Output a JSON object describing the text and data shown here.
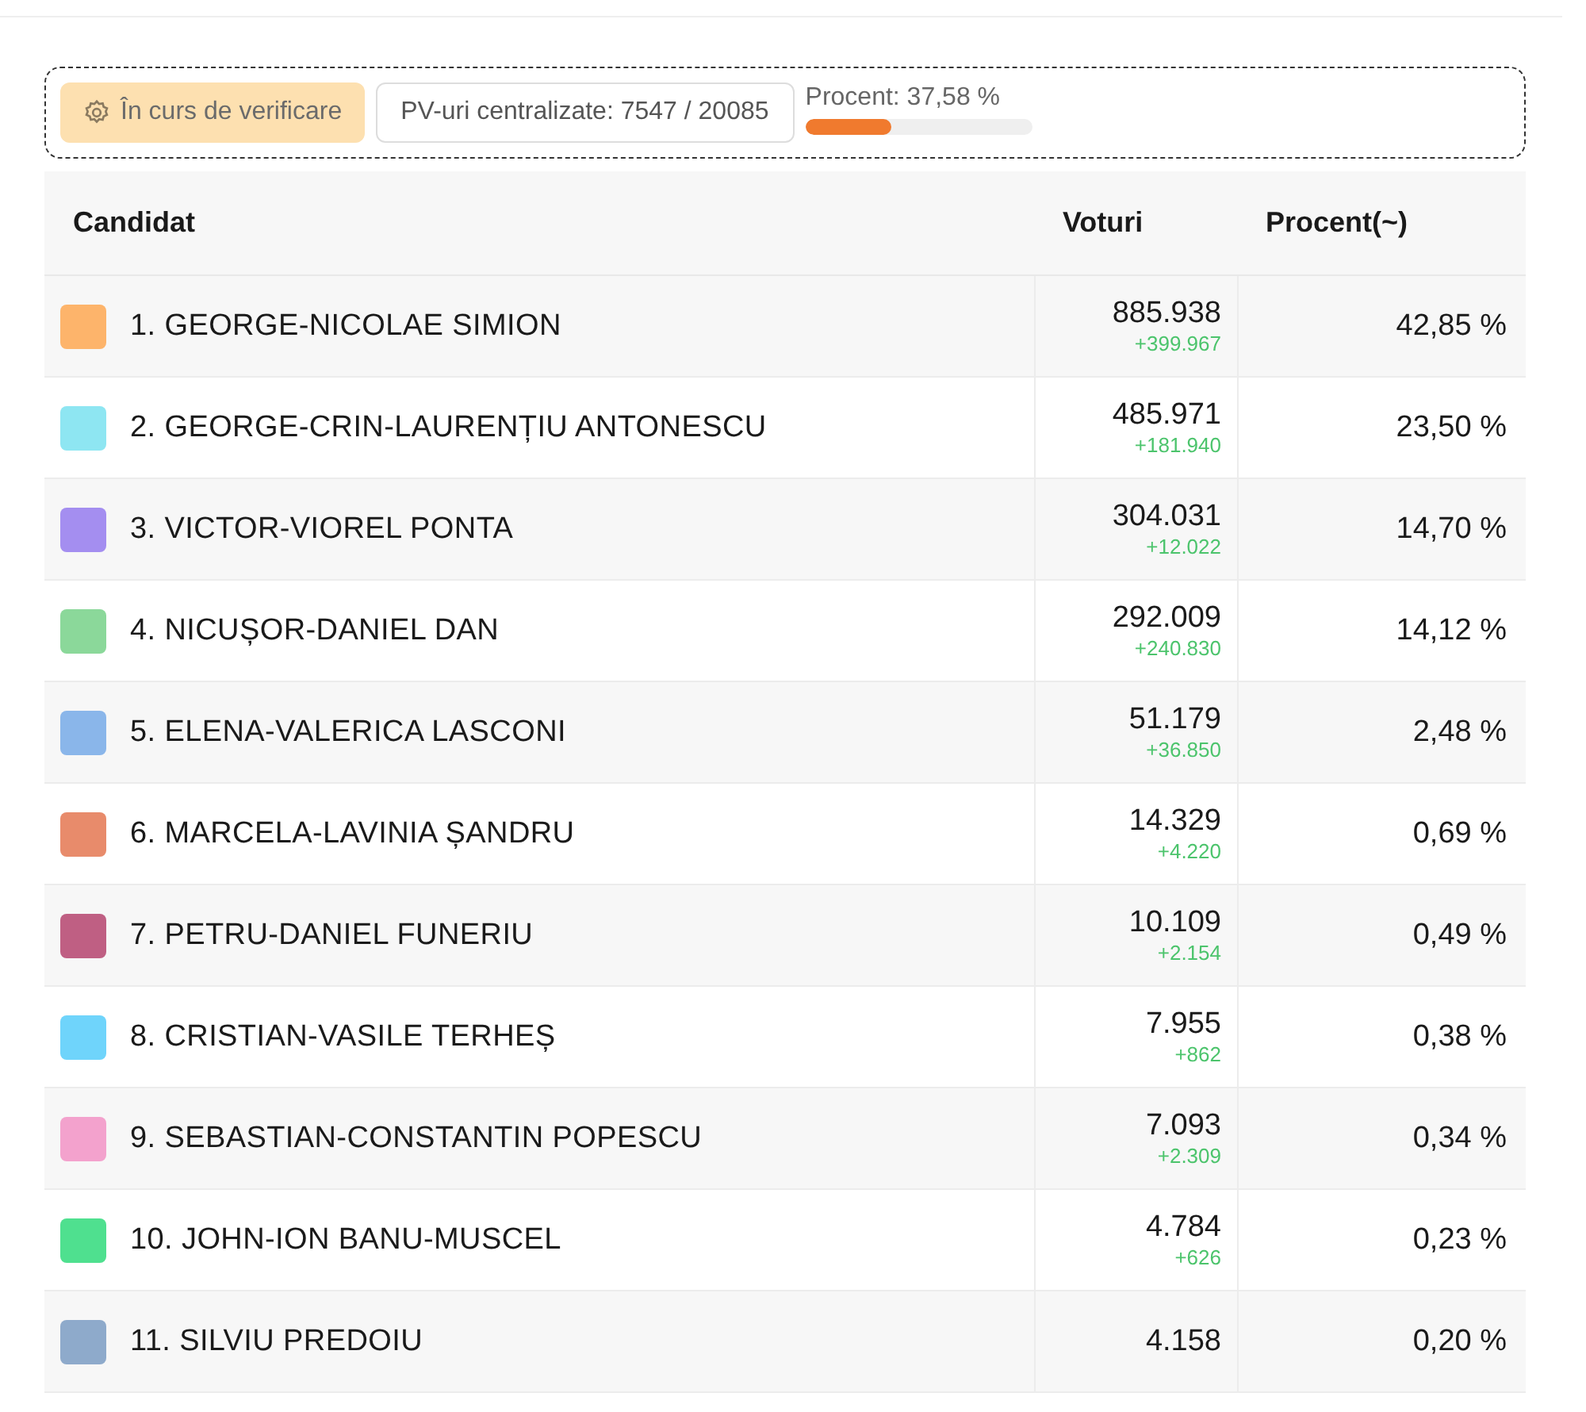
{
  "status": {
    "badge": "În curs de verificare",
    "counted": "PV-uri centralizate: 7547 / 20085",
    "progress_label": "Procent: 37,58 %",
    "level": 0.3758
  },
  "table": {
    "columns": [
      "Candidat",
      "Voturi",
      "Procent(~)"
    ],
    "rows": [
      {
        "name": "1. GEORGE-NICOLAE SIMION",
        "color": "#fdb46b",
        "votes": "885.938",
        "delta": "+399.967",
        "percent": "42,85 %"
      },
      {
        "name": "2. GEORGE-CRIN-LAURENȚIU ANTONESCU",
        "color": "#8ee6f2",
        "votes": "485.971",
        "delta": "+181.940",
        "percent": "23,50 %"
      },
      {
        "name": "3. VICTOR-VIOREL PONTA",
        "color": "#a48ef0",
        "votes": "304.031",
        "delta": "+12.022",
        "percent": "14,70 %"
      },
      {
        "name": "4. NICUȘOR-DANIEL DAN",
        "color": "#8bd89a",
        "votes": "292.009",
        "delta": "+240.830",
        "percent": "14,12 %"
      },
      {
        "name": "5. ELENA-VALERICA LASCONI",
        "color": "#8ab6ea",
        "votes": "51.179",
        "delta": "+36.850",
        "percent": "2,48 %"
      },
      {
        "name": "6. MARCELA-LAVINIA ȘANDRU",
        "color": "#e88b6b",
        "votes": "14.329",
        "delta": "+4.220",
        "percent": "0,69 %"
      },
      {
        "name": "7. PETRU-DANIEL FUNERIU",
        "color": "#bf5f83",
        "votes": "10.109",
        "delta": "+2.154",
        "percent": "0,49 %"
      },
      {
        "name": "8. CRISTIAN-VASILE TERHEȘ",
        "color": "#6fd4fb",
        "votes": "7.955",
        "delta": "+862",
        "percent": "0,38 %"
      },
      {
        "name": "9. SEBASTIAN-CONSTANTIN POPESCU",
        "color": "#f3a2cd",
        "votes": "7.093",
        "delta": "+2.309",
        "percent": "0,34 %"
      },
      {
        "name": "10. JOHN-ION BANU-MUSCEL",
        "color": "#4fe08f",
        "votes": "4.784",
        "delta": "+626",
        "percent": "0,23 %"
      },
      {
        "name": "11. SILVIU PREDOIU",
        "color": "#8eaacb",
        "votes": "4.158",
        "percent": "0,20 %"
      }
    ]
  }
}
